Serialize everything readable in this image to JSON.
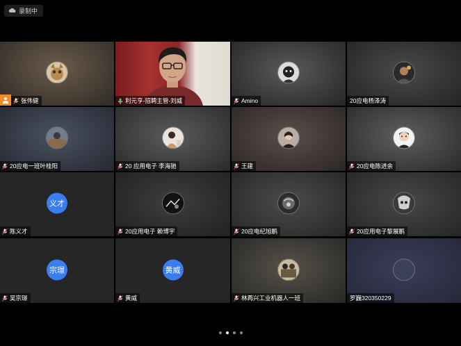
{
  "recording": {
    "label": "录制中"
  },
  "participants": [
    {
      "name": "张伟健",
      "host": true
    },
    {
      "name": "利元亨-招聘主管-刘威",
      "video": true
    },
    {
      "name": "Amino"
    },
    {
      "name": "20应电杨泽涛"
    },
    {
      "name": "20应电一班叶桂阳"
    },
    {
      "name": "20 应用电子 李海驰"
    },
    {
      "name": "王建"
    },
    {
      "name": "20应电陈进余"
    },
    {
      "name": "陈义才",
      "avatar_text": "义才"
    },
    {
      "name": "20应用电子 赖博宇"
    },
    {
      "name": "20应电纪旭鹏"
    },
    {
      "name": "20应用电子黎展鹏"
    },
    {
      "name": "吴宗璟",
      "avatar_text": "宗璟"
    },
    {
      "name": "黄威",
      "avatar_text": "黄威"
    },
    {
      "name": "林再兴工业机器人一班"
    },
    {
      "name": "罗巍320350229"
    }
  ],
  "pagination": {
    "pages": 4,
    "current": 2
  },
  "colors": {
    "avatar_blue": "#3a7df0",
    "host_orange": "#f08a2c"
  }
}
